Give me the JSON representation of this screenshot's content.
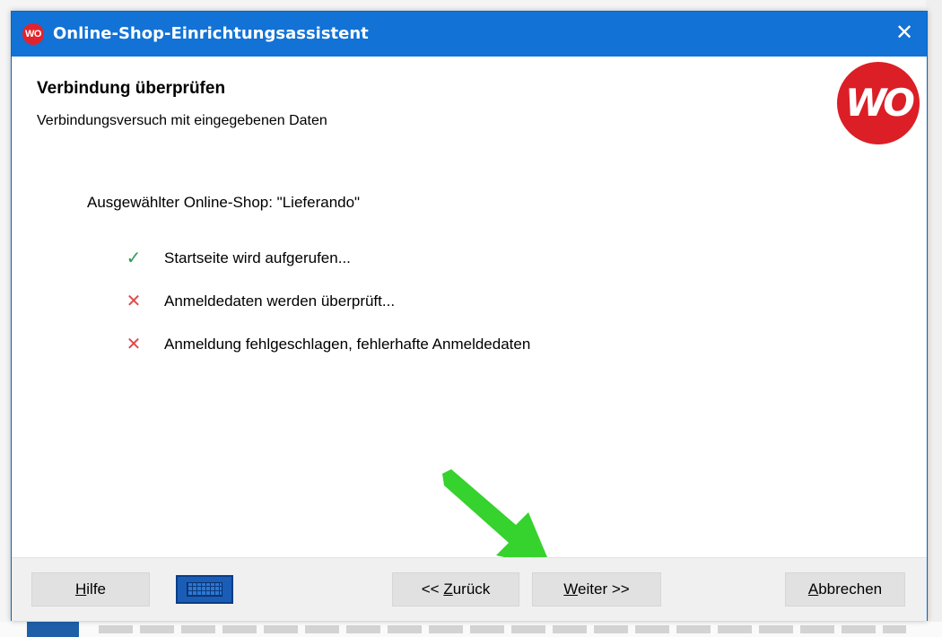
{
  "window": {
    "app_icon_text": "WO",
    "title": "Online-Shop-Einrichtungsassistent",
    "close_glyph": "✕"
  },
  "header": {
    "title": "Verbindung überprüfen",
    "subtitle": "Verbindungsversuch mit eingegebenen Daten",
    "logo_text": "WO"
  },
  "content": {
    "selected_shop": "Ausgewählter Online-Shop: \"Lieferando\"",
    "steps": [
      {
        "status": "success",
        "glyph": "✓",
        "text": "Startseite wird aufgerufen..."
      },
      {
        "status": "error",
        "glyph": "✕",
        "text": "Anmeldedaten werden überprüft..."
      },
      {
        "status": "error",
        "glyph": "✕",
        "text": "Anmeldung fehlgeschlagen, fehlerhafte Anmeldedaten"
      }
    ]
  },
  "buttons": {
    "help_mnemonic": "H",
    "help_rest": "ilfe",
    "back_prefix": "<< ",
    "back_mnemonic": "Z",
    "back_rest": "urück",
    "next_mnemonic": "W",
    "next_rest": "eiter >>",
    "cancel_mnemonic": "A",
    "cancel_rest": "bbrechen"
  },
  "icons": {
    "keyboard": "keyboard-icon",
    "success": "check-icon",
    "error": "cross-icon",
    "annotation": "green-arrow"
  },
  "colors": {
    "titlebar": "#1272d6",
    "brand_red": "#dc1e26",
    "success": "#2e9b5a",
    "error": "#e04848",
    "annotation_arrow": "#36d22e"
  }
}
